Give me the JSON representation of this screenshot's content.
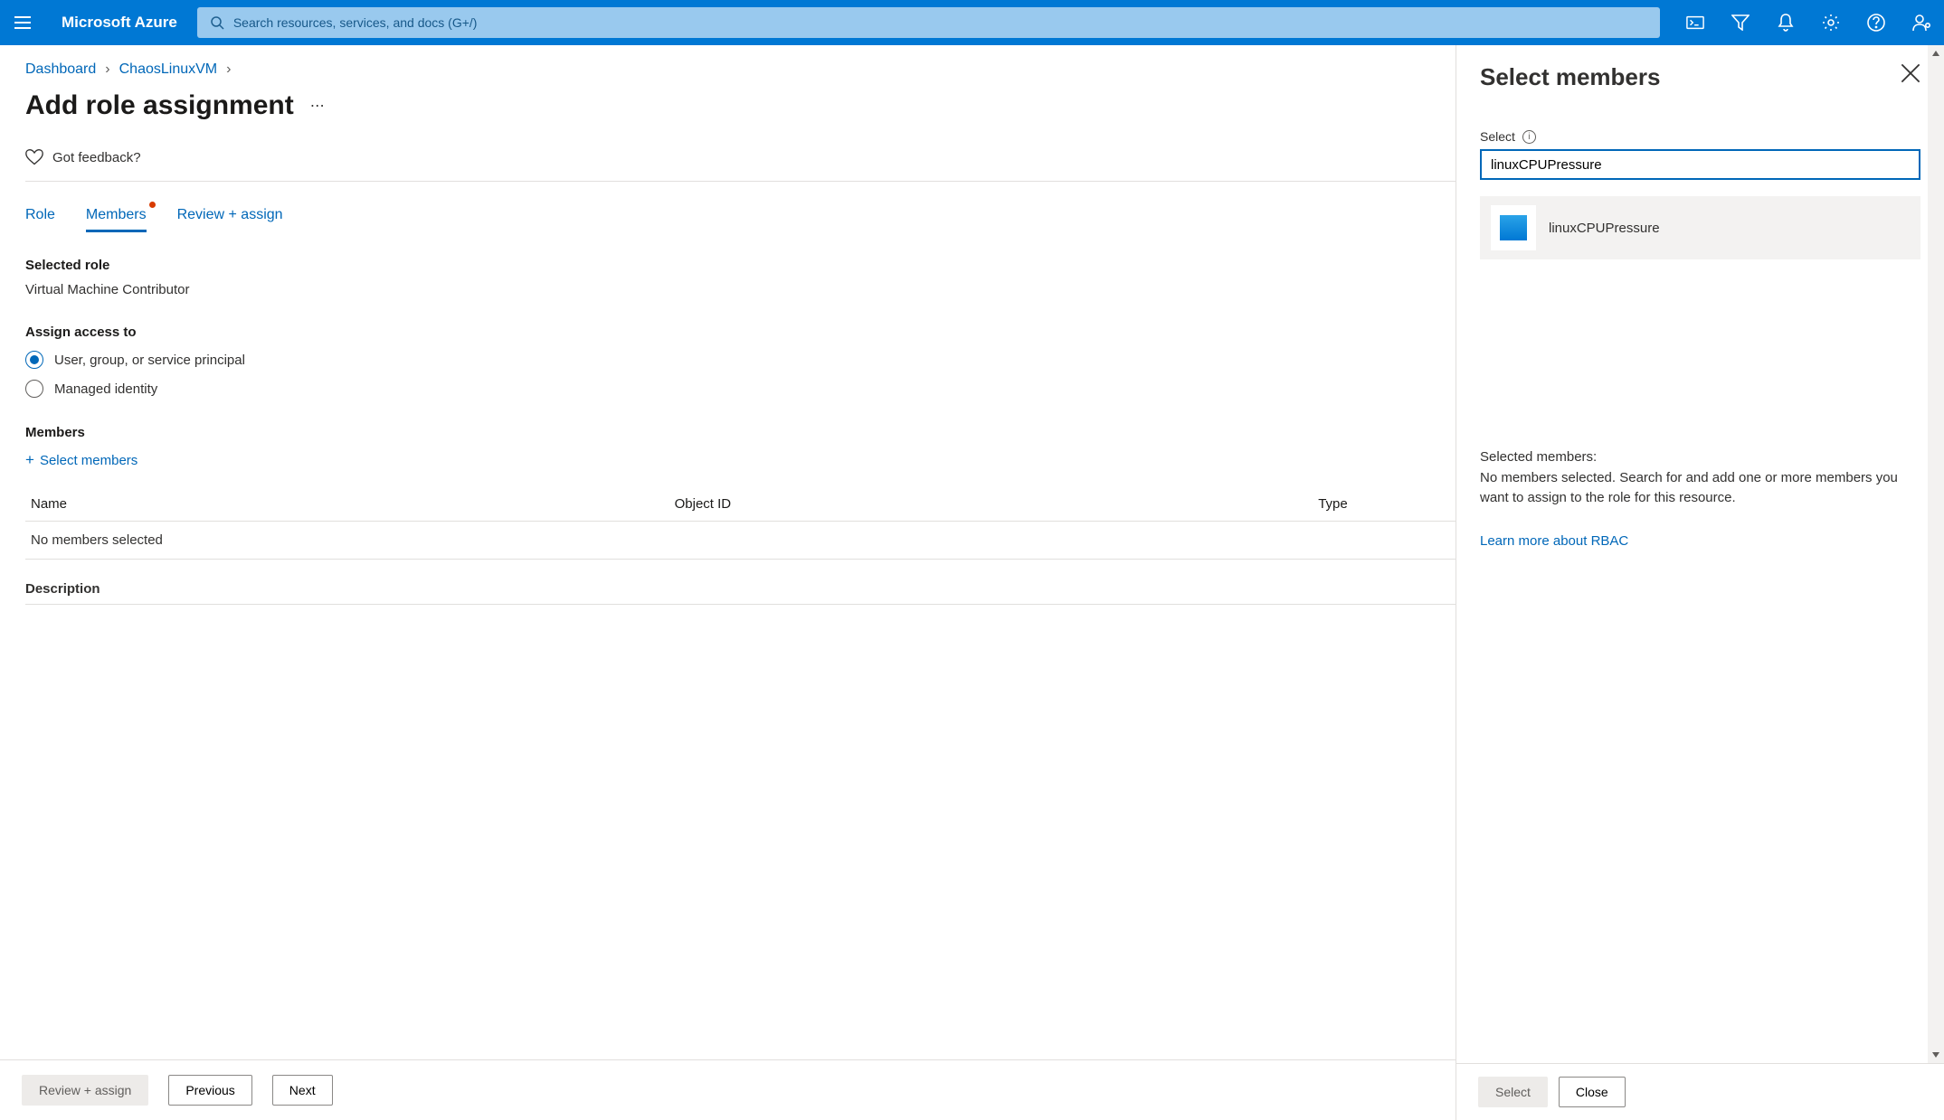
{
  "header": {
    "brand": "Microsoft Azure",
    "search_placeholder": "Search resources, services, and docs (G+/)",
    "icons": [
      "cloud-shell-icon",
      "filter-icon",
      "notifications-icon",
      "settings-icon",
      "help-icon",
      "account-icon"
    ]
  },
  "breadcrumbs": {
    "items": [
      "Dashboard",
      "ChaosLinuxVM"
    ]
  },
  "page": {
    "title": "Add role assignment",
    "feedback": "Got feedback?"
  },
  "tabs": {
    "role": "Role",
    "members": "Members",
    "review": "Review + assign",
    "active": "Members",
    "members_has_indicator": true
  },
  "form": {
    "selected_role_label": "Selected role",
    "selected_role_value": "Virtual Machine Contributor",
    "assign_access_label": "Assign access to",
    "assign_options": {
      "user_group_sp": "User, group, or service principal",
      "managed_identity": "Managed identity"
    },
    "assign_selected": "user_group_sp",
    "members_label": "Members",
    "select_members": "Select members",
    "table_headers": {
      "name": "Name",
      "object_id": "Object ID",
      "type": "Type"
    },
    "no_members": "No members selected",
    "description_label": "Description"
  },
  "footer": {
    "review": "Review + assign",
    "previous": "Previous",
    "next": "Next"
  },
  "panel": {
    "title": "Select members",
    "select_label": "Select",
    "search_value": "linuxCPUPressure",
    "results": [
      {
        "name": "linuxCPUPressure"
      }
    ],
    "selected_members_label": "Selected members:",
    "selected_members_note": "No members selected. Search for and add one or more members you want to assign to the role for this resource.",
    "learn_more": "Learn more about RBAC",
    "footer": {
      "select": "Select",
      "close": "Close"
    }
  }
}
